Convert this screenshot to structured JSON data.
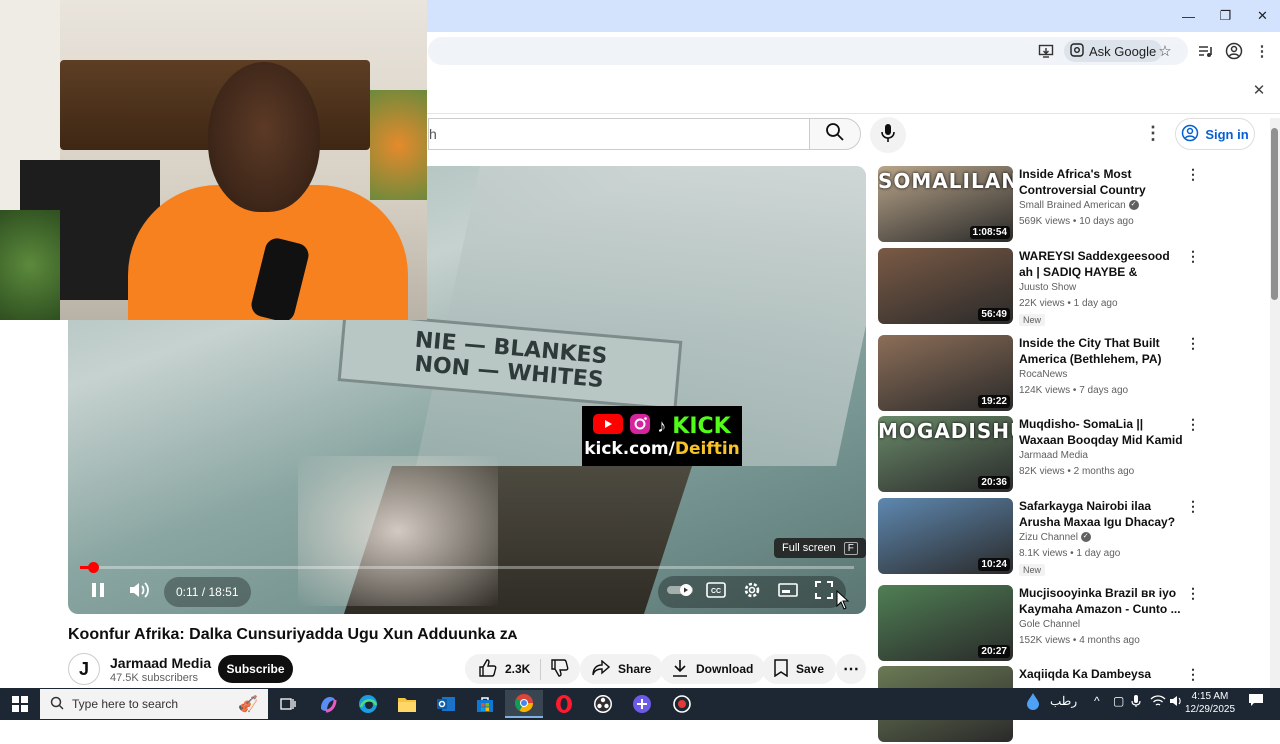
{
  "browser": {
    "ask_google": "Ask Google",
    "window_controls": {
      "minimize": "—",
      "restore": "❐",
      "close": "✕"
    },
    "infobar_close": "✕"
  },
  "youtube": {
    "search_placeholder": "h",
    "sign_in": "Sign in"
  },
  "player": {
    "time": "0:11 / 18:51",
    "progress": 0.0097,
    "tooltip_label": "Full screen",
    "tooltip_key": "F",
    "sign_line1": "NIE — BLANKES",
    "sign_line2": "NON — WHITES",
    "overlay_kick": "KICK",
    "overlay_url_prefix": "kick.com/",
    "overlay_url_name": "Deiftin",
    "colors": {
      "progress": "#ff0000",
      "kick_green": "#53fc18",
      "url_yellow": "#f7c325"
    }
  },
  "video": {
    "title": "Koonfur Afrika: Dalka Cunsuriyadda Ugu Xun Adduunka ᴢᴀ",
    "channel_initial": "J",
    "channel_name": "Jarmaad Media",
    "subscribers": "47.5K subscribers",
    "subscribe": "Subscribe",
    "likes": "2.3K",
    "share": "Share",
    "download": "Download",
    "save": "Save"
  },
  "recommendations": [
    {
      "title": "Inside Africa's Most Controversial Country",
      "channel": "Small Brained American",
      "verified": true,
      "meta": "569K views • 10 days ago",
      "duration": "1:08:54",
      "thumb_text": "SOMALILAND",
      "thumb_color": "#b9a58a",
      "is_new": false
    },
    {
      "title": "WAREYSI Saddexgeesood ah | SADIQ HAYBE & SHAMUREY –...",
      "channel": "Juusto Show",
      "verified": false,
      "meta": "22K views • 1 day ago",
      "duration": "56:49",
      "thumb_text": "",
      "thumb_color": "#7a5a45",
      "is_new": true,
      "new_label": "New"
    },
    {
      "title": "Inside the City That Built America (Bethlehem, PA)",
      "channel": "RocaNews",
      "verified": false,
      "meta": "124K views • 7 days ago",
      "duration": "19:22",
      "thumb_text": "",
      "thumb_color": "#8c6e58",
      "is_new": false
    },
    {
      "title": "Muqdisho- SomaLia || Waxaan Booqday Mid Kamid Ah ...",
      "channel": "Jarmaad Media",
      "verified": false,
      "meta": "82K views • 2 months ago",
      "duration": "20:36",
      "thumb_text": "MOGADISHU",
      "thumb_color": "#6a8a6a",
      "is_new": false
    },
    {
      "title": "Safarkayga Nairobi ilaa Arusha Maxaa Igu Dhacay? Waliga ...",
      "channel": "Zizu Channel",
      "verified": true,
      "meta": "8.1K views • 1 day ago",
      "duration": "10:24",
      "thumb_text": "",
      "thumb_color": "#5e88b0",
      "is_new": true,
      "new_label": "New"
    },
    {
      "title": "Mucjisooyinka Brazil ʙʀ iyo Kaymaha Amazon - Cunto ...",
      "channel": "Gole Channel",
      "verified": false,
      "meta": "152K views • 4 months ago",
      "duration": "20:27",
      "thumb_text": "",
      "thumb_color": "#4f7f54",
      "is_new": false
    },
    {
      "title": "Xaqiiqda Ka Dambeysa",
      "channel": "",
      "verified": false,
      "meta": "",
      "duration": "",
      "thumb_text": "",
      "thumb_color": "#6b7a55",
      "is_new": false
    }
  ],
  "taskbar": {
    "search_placeholder": "Type here to search",
    "keyboard_lang": "رطب",
    "time": "4:15 AM",
    "date": "12/29/2025"
  }
}
